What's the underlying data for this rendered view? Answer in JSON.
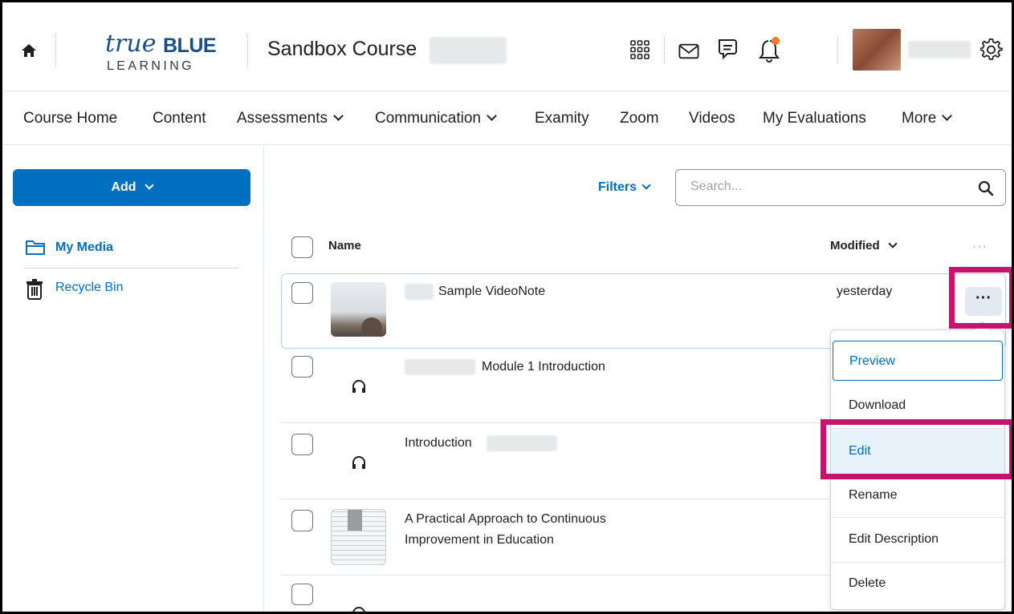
{
  "header": {
    "home_icon": "home-icon",
    "logo": {
      "word1": "true",
      "word2": "BLUE",
      "word3": "LEARNING"
    },
    "course_title": "Sandbox Course",
    "icons": [
      "apps-grid-icon",
      "mail-icon",
      "chat-icon",
      "bell-icon",
      "gear-icon"
    ],
    "notification_dot_color": "#f47a20"
  },
  "nav": {
    "items": [
      {
        "label": "Course Home"
      },
      {
        "label": "Content"
      },
      {
        "label": "Assessments"
      },
      {
        "label": "Communication"
      },
      {
        "label": "Examity"
      },
      {
        "label": "Zoom"
      },
      {
        "label": "Videos"
      },
      {
        "label": "My Evaluations"
      },
      {
        "label": "More"
      }
    ]
  },
  "sidebar": {
    "add_label": "Add",
    "items": [
      {
        "label": "My Media",
        "icon": "folder-icon"
      },
      {
        "label": "Recycle Bin",
        "icon": "trash-icon"
      }
    ]
  },
  "toolbar": {
    "filters_label": "Filters",
    "search_placeholder": "Search..."
  },
  "table": {
    "columns": {
      "name": "Name",
      "modified": "Modified"
    },
    "rows": [
      {
        "title": "Sample VideoNote",
        "modified": "yesterday",
        "thumb": "video-thumbnail"
      },
      {
        "title": "Module 1 Introduction",
        "modified": "",
        "thumb": "headphones-icon"
      },
      {
        "title": "Introduction",
        "modified": "",
        "thumb": "headphones-icon"
      },
      {
        "title_line1": "A Practical Approach to Continuous",
        "title_line2": "Improvement in Education",
        "modified": "",
        "thumb": "document-thumbnail"
      }
    ]
  },
  "context_menu": {
    "items": [
      {
        "label": "Preview"
      },
      {
        "label": "Download"
      },
      {
        "label": "Edit"
      },
      {
        "label": "Rename"
      },
      {
        "label": "Edit Description"
      },
      {
        "label": "Delete"
      }
    ]
  },
  "colors": {
    "accent": "#006fbf",
    "highlight": "#c5146e",
    "logo": "#1a4e8a"
  }
}
